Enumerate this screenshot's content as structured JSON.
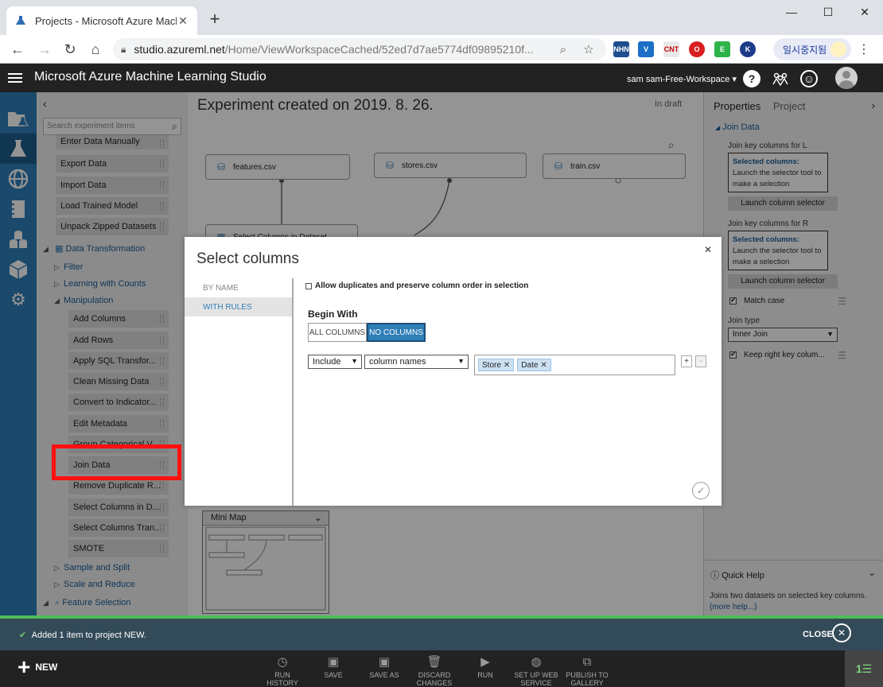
{
  "browser": {
    "tab_title": "Projects - Microsoft Azure Machi",
    "url_host": "studio.azureml.net",
    "url_path": "/Home/ViewWorkspaceCached/52ed7d7ae5774df09895210f...",
    "pause_label": "일시중지됨",
    "extensions": [
      {
        "label": "NHN",
        "color": "#1d4e8e"
      },
      {
        "label": "V",
        "color": "#1b6fc6"
      },
      {
        "label": "CNT",
        "color": "#e8e8e8"
      },
      {
        "label": "O",
        "color": "#d81e1e"
      },
      {
        "label": "E",
        "color": "#2db34a"
      },
      {
        "label": "K",
        "color": "#1e3a8a"
      }
    ]
  },
  "studio": {
    "app_title": "Microsoft Azure Machine Learning Studio",
    "workspace": "sam sam-Free-Workspace ▾"
  },
  "palette": {
    "search_placeholder": "Search experiment items",
    "top_items": [
      "Enter Data Manually",
      "Export Data",
      "Import Data",
      "Load Trained Model",
      "Unpack Zipped Datasets"
    ],
    "category_data_transformation": "Data Transformation",
    "subcat_filter": "Filter",
    "subcat_learning": "Learning with Counts",
    "subcat_manipulation": "Manipulation",
    "manipulation_items": [
      "Add Columns",
      "Add Rows",
      "Apply SQL Transfor...",
      "Clean Missing Data",
      "Convert to Indicator...",
      "Edit Metadata",
      "Group Categorical V...",
      "Join Data",
      "Remove Duplicate R...",
      "Select Columns in D...",
      "Select Columns Tran...",
      "SMOTE"
    ],
    "subcat_sample": "Sample and Split",
    "subcat_scale": "Scale and Reduce",
    "category_feature_selection": "Feature Selection"
  },
  "canvas": {
    "title": "Experiment created on 2019. 8. 26.",
    "status": "In draft",
    "nodes": [
      "features.csv",
      "stores.csv",
      "train.csv",
      "Select Columns in Dataset"
    ],
    "minimap_label": "Mini Map"
  },
  "properties": {
    "tab_properties": "Properties",
    "tab_project": "Project",
    "section": "Join Data",
    "label_key_l": "Join key columns for L",
    "label_key_r": "Join key columns for R",
    "selected_title": "Selected columns:",
    "selected_desc": "Launch the selector tool to make a selection",
    "launch_button": "Launch column selector",
    "match_case": "Match case",
    "join_type_label": "Join type",
    "join_type_value": "Inner Join",
    "keep_right": "Keep right key colum...",
    "quick_help_title": "Quick Help",
    "quick_help_desc": "Joins two datasets on selected key columns.",
    "more_help": "(more help...)"
  },
  "dialog": {
    "title": "Select columns",
    "mode_by_name": "BY NAME",
    "mode_with_rules": "WITH RULES",
    "allow_duplicates": "Allow duplicates and preserve column order in selection",
    "begin_with": "Begin With",
    "all_columns": "ALL COLUMNS",
    "no_columns": "NO COLUMNS",
    "rule_action": "Include",
    "rule_type": "column names",
    "tags": [
      "Store",
      "Date"
    ]
  },
  "notification": {
    "message": "Added 1 item to project NEW.",
    "close_label": "CLOSE"
  },
  "commands": {
    "new": "NEW",
    "run_history": "RUN\nHISTORY",
    "save": "SAVE",
    "save_as": "SAVE AS",
    "discard": "DISCARD\nCHANGES",
    "run": "RUN",
    "setup_web": "SET UP WEB\nSERVICE",
    "publish": "PUBLISH TO\nGALLERY"
  }
}
